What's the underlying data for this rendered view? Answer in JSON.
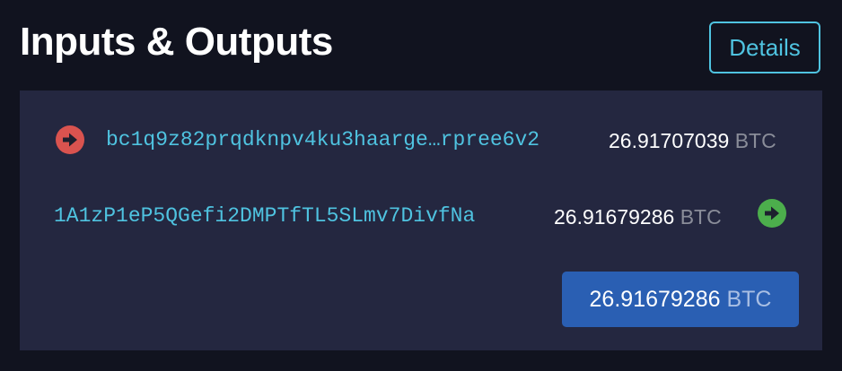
{
  "header": {
    "title": "Inputs & Outputs",
    "details_label": "Details"
  },
  "inputs": [
    {
      "address": "bc1q9z82prqdknpv4ku3haarge…rpree6v2",
      "amount": "26.91707039",
      "unit": "BTC",
      "icon": "arrow-right-circle-red"
    }
  ],
  "outputs": [
    {
      "address": "1A1zP1eP5QGefi2DMPTfTL5SLmv7DivfNa",
      "amount": "26.91679286",
      "unit": "BTC",
      "icon": "arrow-right-circle-green"
    }
  ],
  "total": {
    "amount": "26.91679286",
    "unit": "BTC"
  },
  "colors": {
    "background": "#11131f",
    "panel": "#242740",
    "accent": "#4fc3e0",
    "input_arrow": "#d9534f",
    "output_arrow": "#4cae4c",
    "total_box": "#2a5fb3"
  }
}
